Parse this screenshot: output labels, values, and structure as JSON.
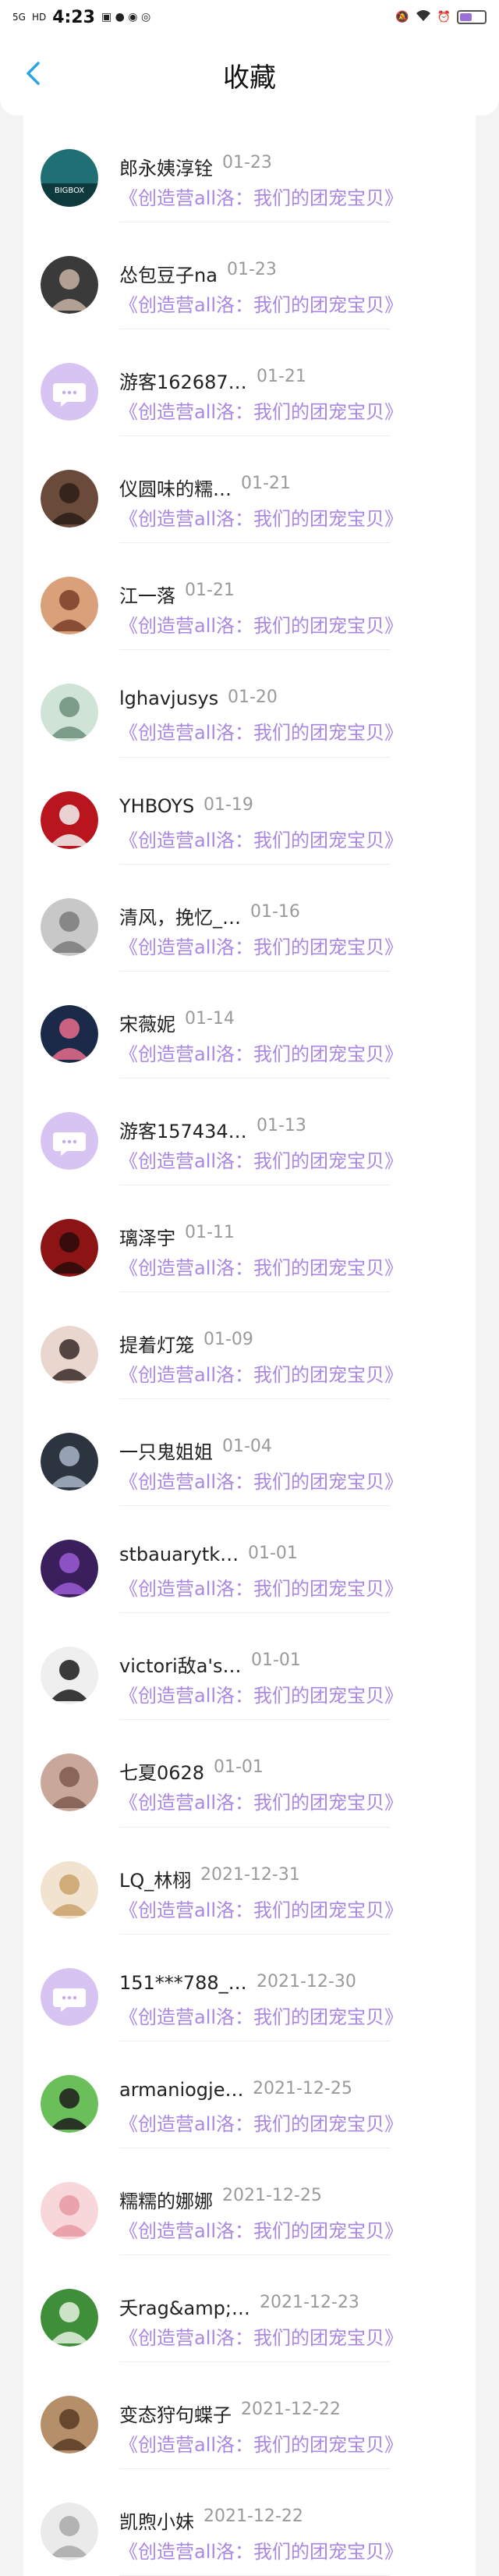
{
  "status_bar": {
    "network": "5G",
    "hd": "HD",
    "time": "4:23"
  },
  "header": {
    "title": "收藏"
  },
  "accent_color": "#a987e3",
  "favorites": [
    {
      "name": "郎永姨淳铨",
      "date": "01-23",
      "item": "《创造营all洛：我们的团宠宝贝》",
      "avatar": "teal-bigbox"
    },
    {
      "name": "怂包豆子na",
      "date": "01-23",
      "item": "《创造营all洛：我们的团宠宝贝》",
      "avatar": "photo-dark"
    },
    {
      "name": "游客162687…",
      "date": "01-21",
      "item": "《创造营all洛：我们的团宠宝贝》",
      "avatar": "default-chat"
    },
    {
      "name": "仪圆味的糯…",
      "date": "01-21",
      "item": "《创造营all洛：我们的团宠宝贝》",
      "avatar": "photo-brown"
    },
    {
      "name": "江一落",
      "date": "01-21",
      "item": "《创造营all洛：我们的团宠宝贝》",
      "avatar": "photo-warm"
    },
    {
      "name": "lghavjusys",
      "date": "01-20",
      "item": "《创造营all洛：我们的团宠宝贝》",
      "avatar": "photo-green"
    },
    {
      "name": "YHBOYS",
      "date": "01-19",
      "item": "《创造营all洛：我们的团宠宝贝》",
      "avatar": "photo-red"
    },
    {
      "name": "清风，挽忆_…",
      "date": "01-16",
      "item": "《创造营all洛：我们的团宠宝贝》",
      "avatar": "photo-gray"
    },
    {
      "name": "宋薇妮",
      "date": "01-14",
      "item": "《创造营all洛：我们的团宠宝贝》",
      "avatar": "photo-night"
    },
    {
      "name": "游客157434…",
      "date": "01-13",
      "item": "《创造营all洛：我们的团宠宝贝》",
      "avatar": "default-chat"
    },
    {
      "name": "璃泽宇",
      "date": "01-11",
      "item": "《创造营all洛：我们的团宠宝贝》",
      "avatar": "photo-crimson"
    },
    {
      "name": "提着灯笼",
      "date": "01-09",
      "item": "《创造营all洛：我们的团宠宝贝》",
      "avatar": "photo-portrait"
    },
    {
      "name": "一只鬼姐姐",
      "date": "01-04",
      "item": "《创造营all洛：我们的团宠宝贝》",
      "avatar": "photo-cool"
    },
    {
      "name": "stbauarytk…",
      "date": "01-01",
      "item": "《创造营all洛：我们的团宠宝贝》",
      "avatar": "photo-purple"
    },
    {
      "name": "victori敌a's…",
      "date": "01-01",
      "item": "《创造营all洛：我们的团宠宝贝》",
      "avatar": "photo-bw"
    },
    {
      "name": "七夏0628",
      "date": "01-01",
      "item": "《创造营all洛：我们的团宠宝贝》",
      "avatar": "photo-floral"
    },
    {
      "name": "LQ_林栩",
      "date": "2021-12-31",
      "item": "《创造营all洛：我们的团宠宝贝》",
      "avatar": "photo-blonde"
    },
    {
      "name": "151***788_…",
      "date": "2021-12-30",
      "item": "《创造营all洛：我们的团宠宝贝》",
      "avatar": "default-chat"
    },
    {
      "name": "armaniogje…",
      "date": "2021-12-25",
      "item": "《创造营all洛：我们的团宠宝贝》",
      "avatar": "photo-cartoon"
    },
    {
      "name": "糯糯的娜娜",
      "date": "2021-12-25",
      "item": "《创造营all洛：我们的团宠宝贝》",
      "avatar": "photo-pink"
    },
    {
      "name": "夭rag&amp;…",
      "date": "2021-12-23",
      "item": "《创造营all洛：我们的团宠宝贝》",
      "avatar": "photo-plant"
    },
    {
      "name": "变态狩句蝶子",
      "date": "2021-12-22",
      "item": "《创造营all洛：我们的团宠宝贝》",
      "avatar": "photo-sepia"
    },
    {
      "name": "凯煦小妹",
      "date": "2021-12-22",
      "item": "《创造营all洛：我们的团宠宝贝》",
      "avatar": "photo-light"
    }
  ]
}
